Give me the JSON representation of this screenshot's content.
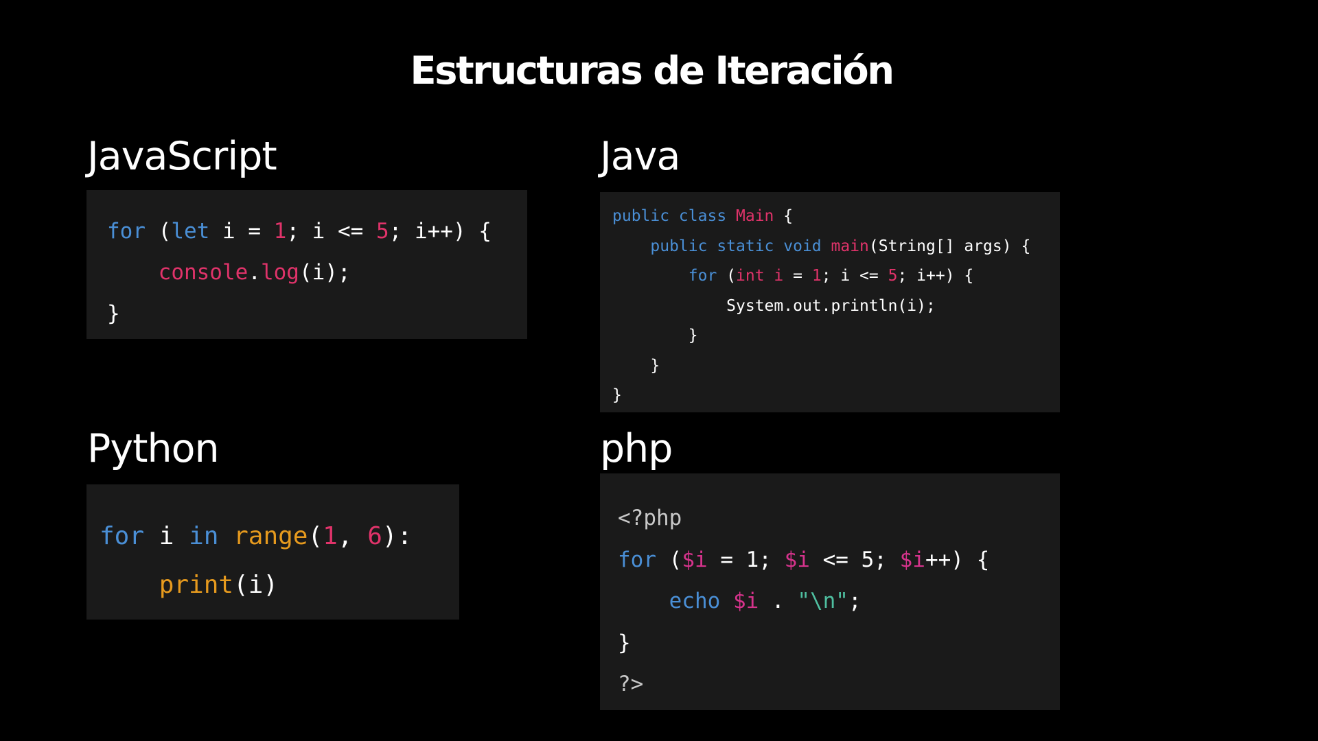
{
  "slide": {
    "title": "Estructuras de Iteración"
  },
  "sections": {
    "javascript": {
      "label": "JavaScript",
      "lines": [
        [
          {
            "t": "for",
            "c": "keyword"
          },
          {
            "t": " (",
            "c": "punct"
          },
          {
            "t": "let",
            "c": "keyword"
          },
          {
            "t": " i = ",
            "c": "ident"
          },
          {
            "t": "1",
            "c": "num"
          },
          {
            "t": "; i <= ",
            "c": "ident"
          },
          {
            "t": "5",
            "c": "num"
          },
          {
            "t": "; i++) {",
            "c": "ident"
          }
        ],
        [
          {
            "t": "    ",
            "c": "ident"
          },
          {
            "t": "console",
            "c": "fn"
          },
          {
            "t": ".",
            "c": "punct"
          },
          {
            "t": "log",
            "c": "fn"
          },
          {
            "t": "(i);",
            "c": "ident"
          }
        ],
        [
          {
            "t": "}",
            "c": "punct"
          }
        ]
      ]
    },
    "java": {
      "label": "Java",
      "lines": [
        [
          {
            "t": "public class ",
            "c": "keyword"
          },
          {
            "t": "Main",
            "c": "classname"
          },
          {
            "t": " {",
            "c": "punct"
          }
        ],
        [
          {
            "t": "    ",
            "c": "ident"
          },
          {
            "t": "public static void ",
            "c": "keyword"
          },
          {
            "t": "main",
            "c": "fn"
          },
          {
            "t": "(String[] args) {",
            "c": "ident"
          }
        ],
        [
          {
            "t": "        ",
            "c": "ident"
          },
          {
            "t": "for",
            "c": "keyword"
          },
          {
            "t": " (",
            "c": "punct"
          },
          {
            "t": "int i",
            "c": "fn"
          },
          {
            "t": " = ",
            "c": "ident"
          },
          {
            "t": "1",
            "c": "num"
          },
          {
            "t": "; i <= ",
            "c": "ident"
          },
          {
            "t": "5",
            "c": "num"
          },
          {
            "t": "; i++) {",
            "c": "ident"
          }
        ],
        [
          {
            "t": "            System.out.println(i);",
            "c": "ident"
          }
        ],
        [
          {
            "t": "        }",
            "c": "punct"
          }
        ],
        [
          {
            "t": "    }",
            "c": "punct"
          }
        ],
        [
          {
            "t": "}",
            "c": "punct"
          }
        ]
      ]
    },
    "python": {
      "label": "Python",
      "lines": [
        [
          {
            "t": "for",
            "c": "keyword"
          },
          {
            "t": " i ",
            "c": "ident"
          },
          {
            "t": "in",
            "c": "keyword"
          },
          {
            "t": " ",
            "c": "ident"
          },
          {
            "t": "range",
            "c": "py-fn"
          },
          {
            "t": "(",
            "c": "punct"
          },
          {
            "t": "1",
            "c": "num"
          },
          {
            "t": ", ",
            "c": "punct"
          },
          {
            "t": "6",
            "c": "num"
          },
          {
            "t": "):",
            "c": "punct"
          }
        ],
        [
          {
            "t": "    ",
            "c": "ident"
          },
          {
            "t": "print",
            "c": "py-fn"
          },
          {
            "t": "(i)",
            "c": "ident"
          }
        ]
      ]
    },
    "php": {
      "label": "php",
      "lines": [
        [
          {
            "t": "<?php",
            "c": "php-tag"
          }
        ],
        [
          {
            "t": "for",
            "c": "keyword"
          },
          {
            "t": " (",
            "c": "punct"
          },
          {
            "t": "$i",
            "c": "php-var"
          },
          {
            "t": " = 1; ",
            "c": "ident"
          },
          {
            "t": "$i",
            "c": "php-var"
          },
          {
            "t": " <= 5; ",
            "c": "ident"
          },
          {
            "t": "$i",
            "c": "php-var"
          },
          {
            "t": "++) {",
            "c": "ident"
          }
        ],
        [
          {
            "t": "    ",
            "c": "ident"
          },
          {
            "t": "echo",
            "c": "keyword"
          },
          {
            "t": " ",
            "c": "ident"
          },
          {
            "t": "$i",
            "c": "php-var"
          },
          {
            "t": " . ",
            "c": "ident"
          },
          {
            "t": "\"\\n\"",
            "c": "php-str"
          },
          {
            "t": ";",
            "c": "punct"
          }
        ],
        [
          {
            "t": "}",
            "c": "punct"
          }
        ],
        [
          {
            "t": "?>",
            "c": "php-tag"
          }
        ]
      ]
    }
  },
  "colors": {
    "background": "#000000",
    "code_background": "#1a1a1a",
    "keyword": "#4a8fd6",
    "function": "#e0336a",
    "number": "#e0336a",
    "python_function": "#e69a1e",
    "php_variable": "#d6338c",
    "php_string": "#4fbfa0"
  }
}
